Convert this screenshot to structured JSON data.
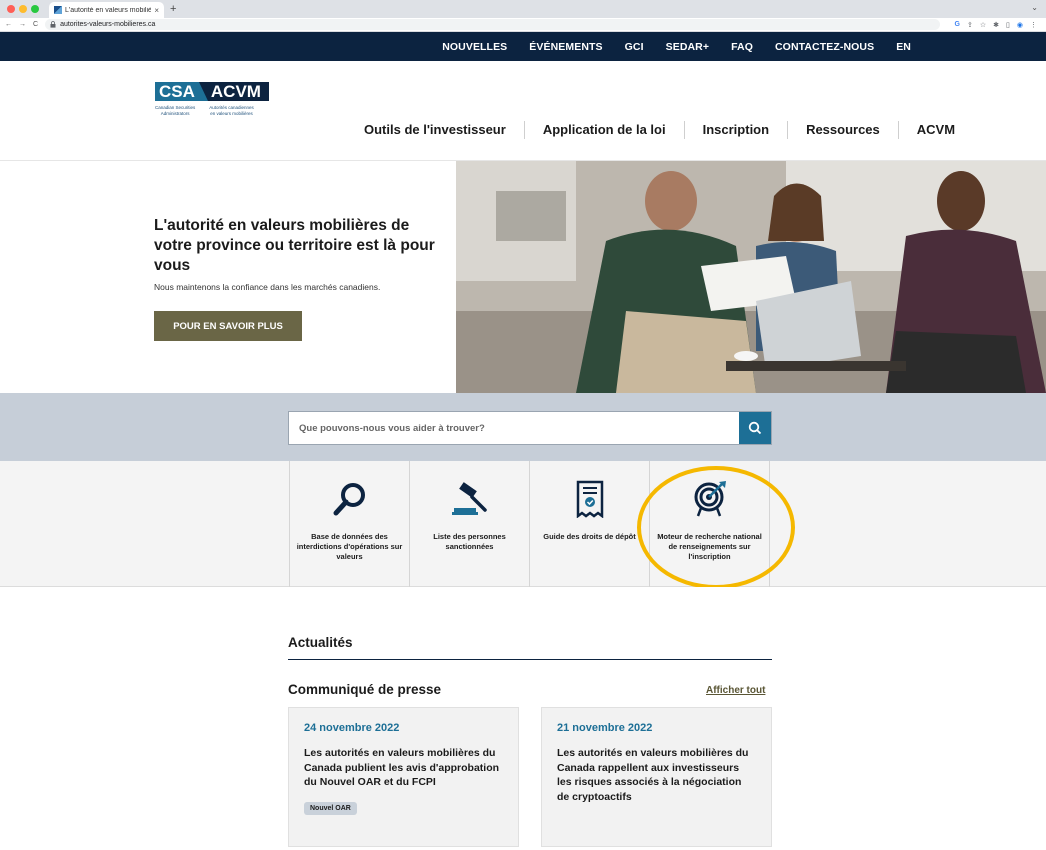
{
  "browser": {
    "tab_title": "L'autorité en valeurs mobilières",
    "tab_close": "×",
    "new_tab": "+",
    "url": "autorites-valeurs-mobilieres.ca",
    "back": "←",
    "forward": "→",
    "reload": "C",
    "lock": "🔒",
    "menu": "⌄"
  },
  "topnav": {
    "items": [
      "NOUVELLES",
      "ÉVÉNEMENTS",
      "GCI",
      "SEDAR+",
      "FAQ",
      "CONTACTEZ-NOUS"
    ],
    "lang": "EN",
    "bg_color": "#0c2340"
  },
  "logo": {
    "csa": "CSA",
    "acvm": "ACVM",
    "en_line1": "Canadian Securities",
    "en_line2": "Administrators",
    "fr_line1": "Autorités canadiennes",
    "fr_line2": "en valeurs mobilières"
  },
  "mainnav": {
    "items": [
      "Outils de l'investisseur",
      "Application de la loi",
      "Inscription",
      "Ressources",
      "ACVM"
    ]
  },
  "hero": {
    "title": "L'autorité en valeurs mobilières de votre province ou territoire est là pour vous",
    "text": "Nous maintenons la confiance dans les marchés canadiens.",
    "button": "POUR EN SAVOIR PLUS",
    "button_color": "#6a6646"
  },
  "search": {
    "placeholder": "Que pouvons-nous vous aider à trouver?",
    "button_color": "#1d6f96"
  },
  "tools": [
    {
      "label": "Base de données des interdictions d'opérations sur valeurs",
      "icon": "magnifier-icon"
    },
    {
      "label": "Liste des personnes sanctionnées",
      "icon": "gavel-icon"
    },
    {
      "label": "Guide des droits de dépôt",
      "icon": "receipt-icon"
    },
    {
      "label": "Moteur de recherche national de renseignements sur l'inscription",
      "icon": "target-icon"
    }
  ],
  "news": {
    "title": "Actualités",
    "press_title": "Communiqué de presse",
    "view_all": "Afficher tout",
    "cards": [
      {
        "date": "24 novembre 2022",
        "text": "Les autorités en valeurs mobilières du Canada publient les avis d'approbation du Nouvel OAR et du FCPI",
        "tag": "Nouvel OAR"
      },
      {
        "date": "21 novembre 2022",
        "text": "Les autorités en valeurs mobilières du Canada rappellent aux investisseurs les risques associés à la négociation de cryptoactifs",
        "tag": ""
      }
    ]
  }
}
